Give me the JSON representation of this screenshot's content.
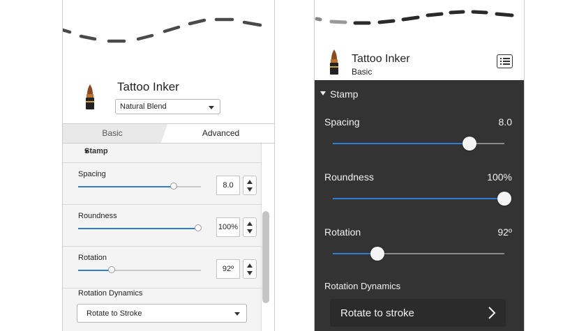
{
  "left_panel": {
    "brush_name": "Tattoo Inker",
    "blend_select": "Natural Blend",
    "tabs": [
      {
        "label": "Basic",
        "active": false
      },
      {
        "label": "Advanced",
        "active": true
      }
    ],
    "section": "Stamp",
    "controls": [
      {
        "label": "Spacing",
        "value": "8.0",
        "level": 0.78
      },
      {
        "label": "Roundness",
        "value": "100%",
        "level": 0.98
      },
      {
        "label": "Rotation",
        "value": "92º",
        "level": 0.27
      }
    ],
    "rotation_dynamics_label": "Rotation Dynamics",
    "rotation_dynamics_value": "Rotate to Stroke"
  },
  "right_panel": {
    "brush_name": "Tattoo Inker",
    "brush_subtitle": "Basic",
    "section": "Stamp",
    "controls": [
      {
        "label": "Spacing",
        "value": "8.0",
        "level": 0.795
      },
      {
        "label": "Roundness",
        "value": "100%",
        "level": 1.0
      },
      {
        "label": "Rotation",
        "value": "92º",
        "level": 0.26
      }
    ],
    "rotation_dynamics_label": "Rotation Dynamics",
    "rotation_dynamics_value": "Rotate to stroke"
  },
  "colors": {
    "accent": "#2f7dd6",
    "dark_panel": "#333333",
    "stroke": "#444444"
  },
  "icons": {
    "brush": "tattoo-inker-brush-icon",
    "list": "list-icon",
    "chevron": "chevron-right-icon"
  }
}
